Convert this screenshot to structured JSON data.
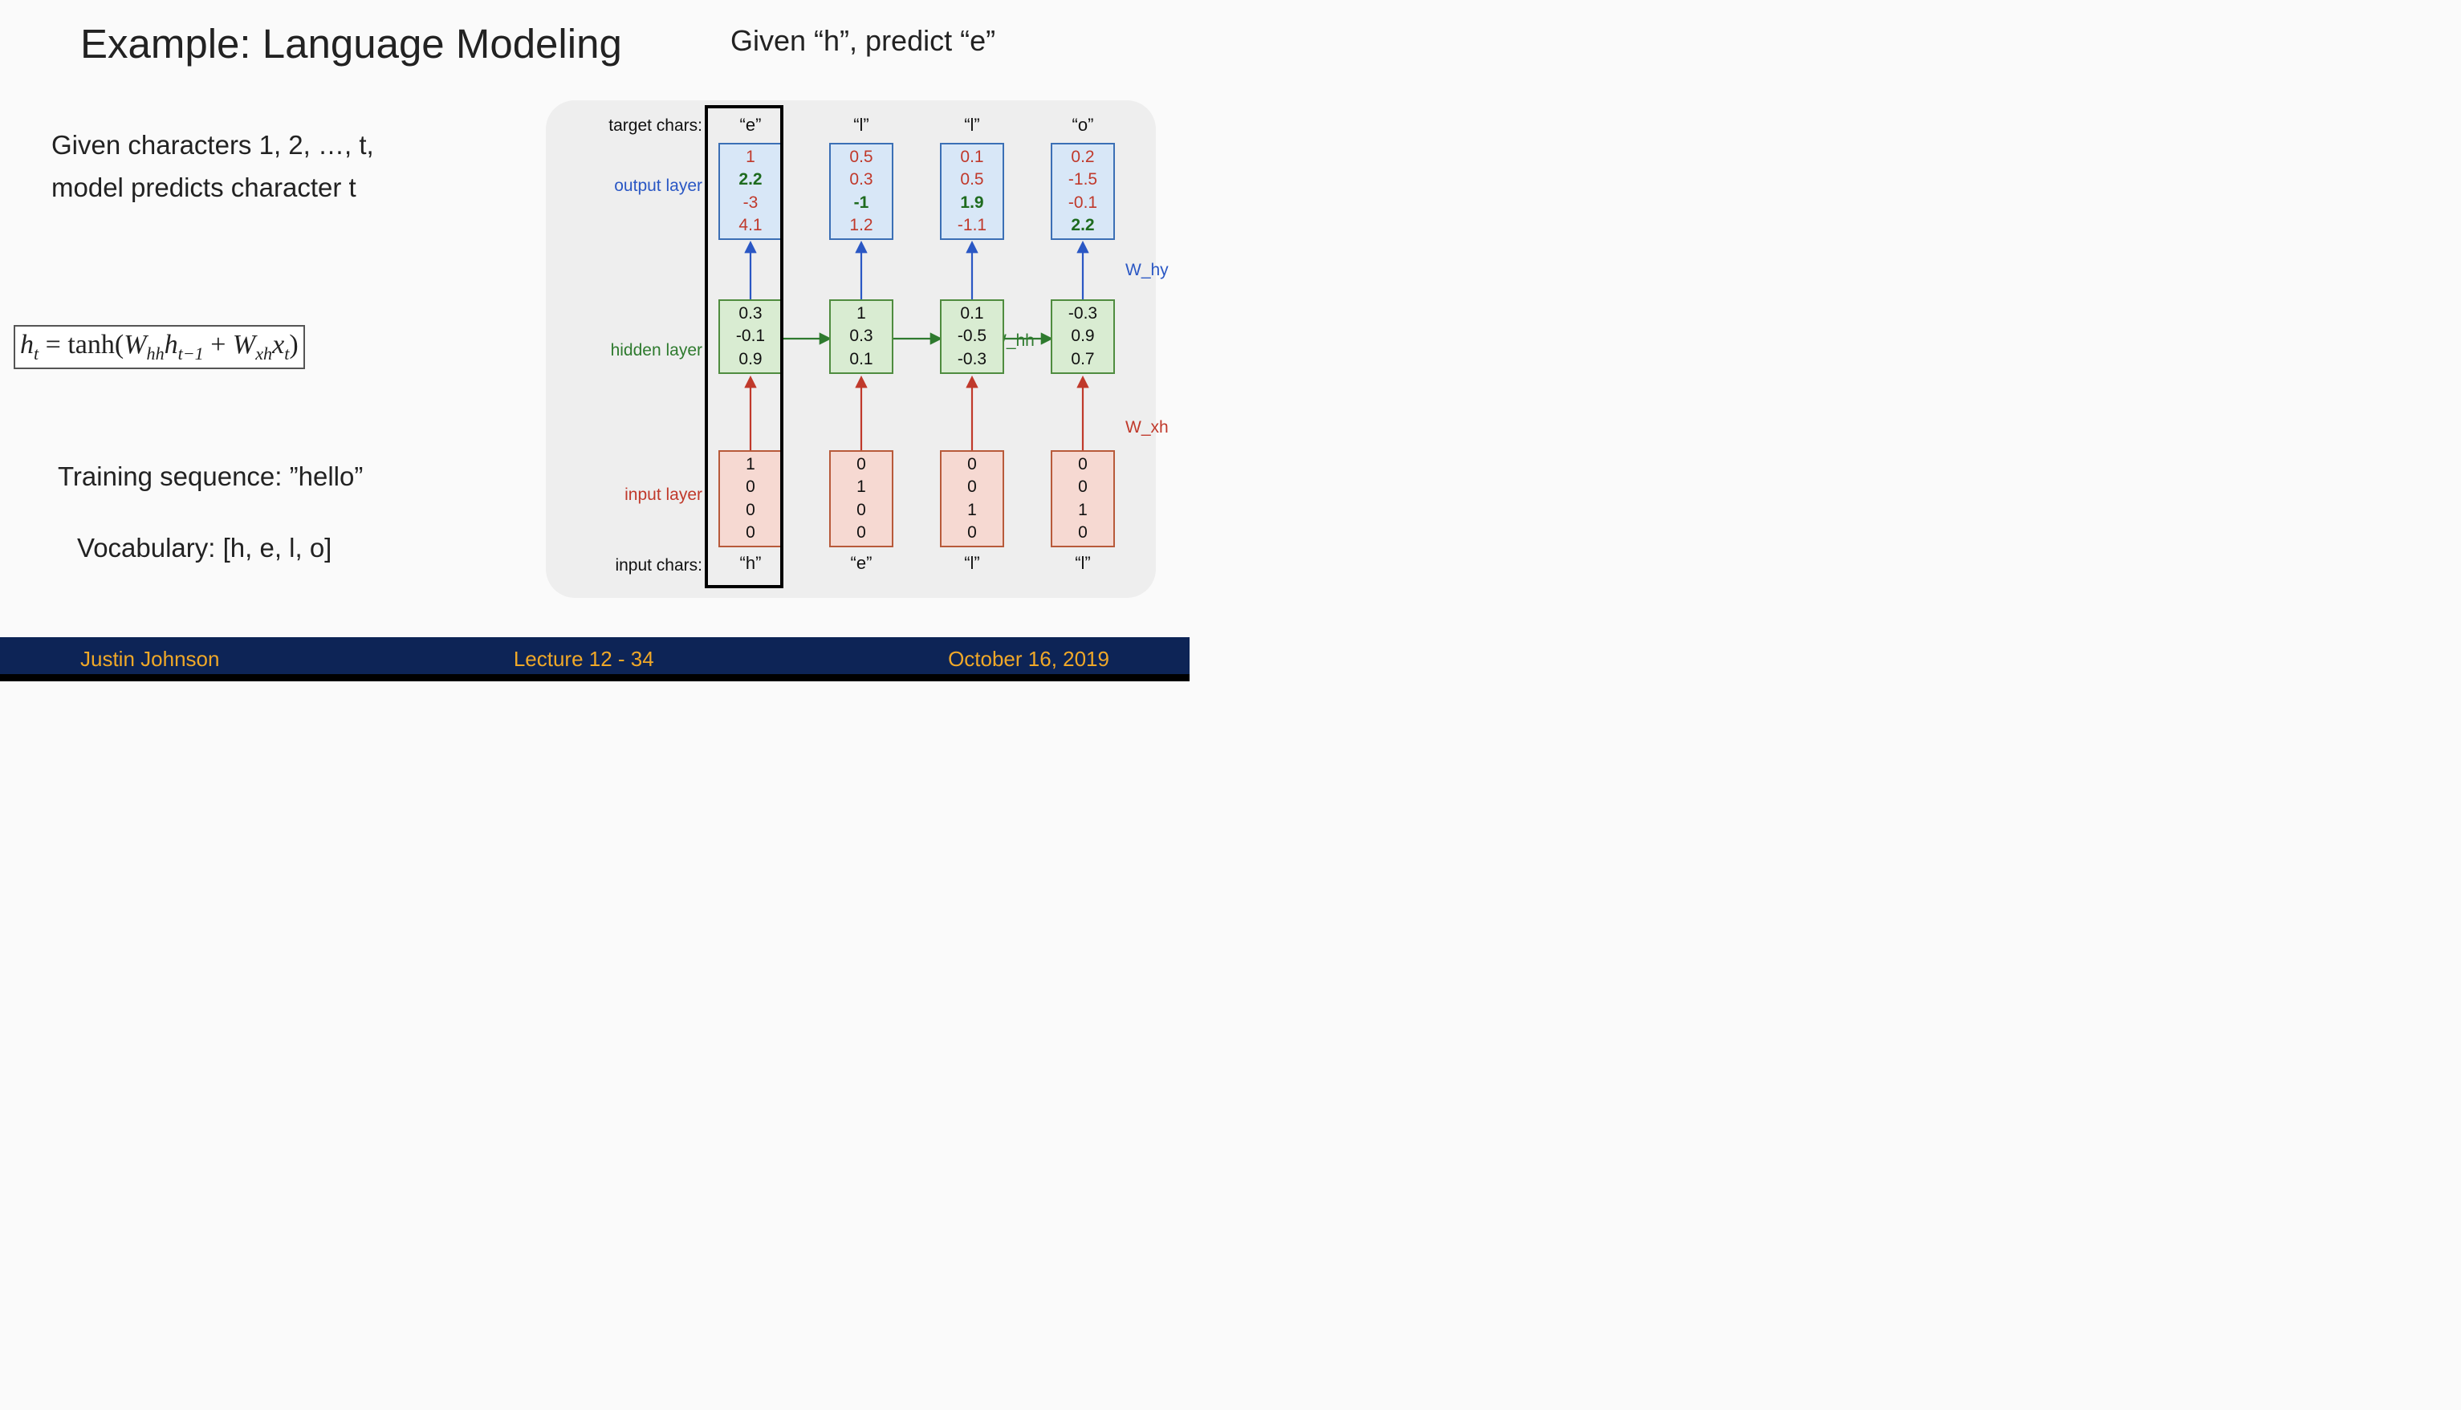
{
  "title": "Example: Language Modeling",
  "subtitle_right": "Given “h”, predict “e”",
  "intro_line1": "Given characters 1, 2, …, t,",
  "intro_line2": "model predicts character t",
  "formula_html": "h<sub>t</sub> <span class='rm'>=</span> <span class='rm'>tanh(</span>W<sub>hh</sub>h<sub>t−1</sub> <span class='rm'>+</span> W<sub>xh</sub>x<sub>t</sub><span class='rm'>)</span>",
  "training_sequence": "Training sequence: ”hello”",
  "vocabulary": "Vocabulary: [h, e, l, o]",
  "row_labels": {
    "target": "target chars:",
    "output": "output layer",
    "hidden": "hidden layer",
    "input": "input layer",
    "input_chars": "input chars:"
  },
  "weight_labels": {
    "w_hy": "W_hy",
    "w_hh": "W_hh",
    "w_xh": "W_xh"
  },
  "chart_data": {
    "type": "table",
    "vocab": [
      "h",
      "e",
      "l",
      "o"
    ],
    "timesteps": [
      {
        "input_char": "“h”",
        "target_char": "“e”",
        "input_onehot": [
          1,
          0,
          0,
          0
        ],
        "hidden": [
          0.3,
          -0.1,
          0.9
        ],
        "output": [
          {
            "value": 1.0,
            "correct": false
          },
          {
            "value": 2.2,
            "correct": true
          },
          {
            "value": -3.0,
            "correct": false
          },
          {
            "value": 4.1,
            "correct": false
          }
        ],
        "highlighted": true
      },
      {
        "input_char": "“e”",
        "target_char": "“l”",
        "input_onehot": [
          0,
          1,
          0,
          0
        ],
        "hidden": [
          1.0,
          0.3,
          0.1
        ],
        "output": [
          {
            "value": 0.5,
            "correct": false
          },
          {
            "value": 0.3,
            "correct": false
          },
          {
            "value": -1.0,
            "correct": true
          },
          {
            "value": 1.2,
            "correct": false
          }
        ],
        "highlighted": false
      },
      {
        "input_char": "“l”",
        "target_char": "“l”",
        "input_onehot": [
          0,
          0,
          1,
          0
        ],
        "hidden": [
          0.1,
          -0.5,
          -0.3
        ],
        "output": [
          {
            "value": 0.1,
            "correct": false
          },
          {
            "value": 0.5,
            "correct": false
          },
          {
            "value": 1.9,
            "correct": true
          },
          {
            "value": -1.1,
            "correct": false
          }
        ],
        "highlighted": false
      },
      {
        "input_char": "“l”",
        "target_char": "“o”",
        "input_onehot": [
          0,
          0,
          1,
          0
        ],
        "hidden": [
          -0.3,
          0.9,
          0.7
        ],
        "output": [
          {
            "value": 0.2,
            "correct": false
          },
          {
            "value": -1.5,
            "correct": false
          },
          {
            "value": -0.1,
            "correct": false
          },
          {
            "value": 2.2,
            "correct": true
          }
        ],
        "highlighted": false
      }
    ]
  },
  "footer": {
    "author": "Justin Johnson",
    "center": "Lecture 12 - 34",
    "date": "October 16, 2019"
  }
}
